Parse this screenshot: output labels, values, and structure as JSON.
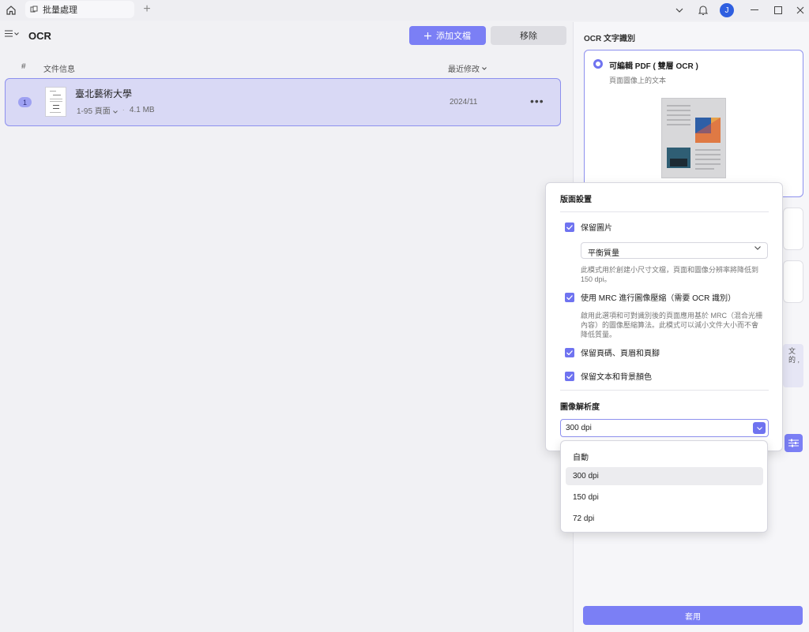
{
  "titlebar": {
    "tab_label": "批量處理",
    "avatar_initial": "J"
  },
  "toolbar": {
    "title": "OCR",
    "add_label": "添加文檔",
    "remove_label": "移除"
  },
  "table": {
    "col_index": "#",
    "col_info": "文件信息",
    "col_modified": "最近修改"
  },
  "files": [
    {
      "index": "1",
      "name": "臺北藝術大學",
      "pages": "1-95 頁面",
      "size": "4.1 MB",
      "date": "2024/11"
    }
  ],
  "ocr_panel": {
    "title": "OCR 文字識別",
    "option_label": "可編輯 PDF ( 雙層 OCR )",
    "option_sub": "頁面圖像上的文本",
    "side_text": "文 的 ,",
    "apply_label": "套用"
  },
  "layout_popover": {
    "title": "版面設置",
    "keep_images": "保留圖片",
    "quality_value": "平衡質量",
    "quality_help": "此模式用於創建小尺寸文檔，頁面和圖像分辨率將降低到 150 dpi。",
    "mrc_label": "使用 MRC 進行圖像壓縮（需要 OCR 識別）",
    "mrc_help": "啟用此選項和可對識別後的頁面應用基於 MRC（混合光柵內容）的圖像壓縮算法。此模式可以減小文件大小而不會降低質量。",
    "keep_header": "保留頁碼、頁眉和頁腳",
    "keep_colors": "保留文本和背景顏色",
    "resolution_label": "圖像解析度",
    "resolution_value": "300 dpi",
    "resolution_options": [
      "自動",
      "300 dpi",
      "150 dpi",
      "72 dpi"
    ]
  },
  "colors": {
    "accent": "#7b7ff5",
    "accent_dark": "#6f73f0",
    "row_selected": "#d9d9f5"
  }
}
